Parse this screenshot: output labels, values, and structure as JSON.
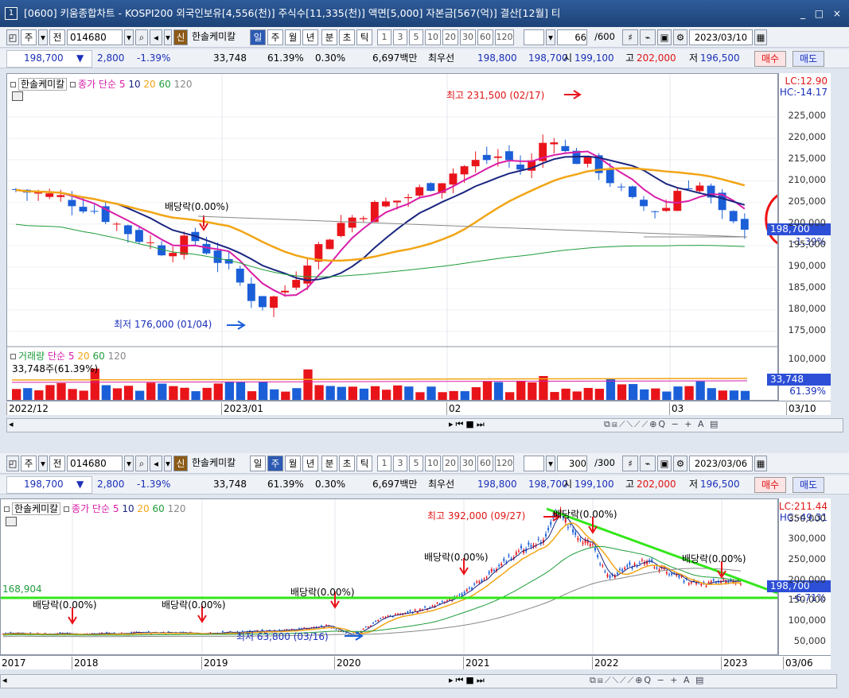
{
  "window": {
    "title": "[0600] 키움종합차트 - KOSPI200 외국인보유[4,556(천)] 주식수[11,335(천)] 액면[5,000] 자본금[567(억)] 결산[12월] 티",
    "number_icon": "1",
    "controls": "_ □ ×"
  },
  "top": {
    "toolbar": {
      "mode": "주",
      "jeon": "전",
      "code": "014680",
      "shin": "신",
      "name": "한솔케미칼",
      "periods": [
        "일",
        "주",
        "월",
        "년"
      ],
      "active_period": "일",
      "intervals": [
        "분",
        "초",
        "틱"
      ],
      "nums": [
        "1",
        "3",
        "5",
        "10",
        "20",
        "30",
        "60",
        "120"
      ],
      "count": "66",
      "count_total": "/600",
      "date": "2023/03/10"
    },
    "quote": {
      "price": "198,700",
      "arrow": "▼",
      "change": "2,800",
      "pct": "-1.39%",
      "volume": "33,748",
      "vol_ratio": "61.39%",
      "turnover": "0.30%",
      "amount": "6,697백만",
      "best_label": "최우선",
      "best_ask": "198,800",
      "best_bid": "198,700",
      "open_label": "시",
      "open": "199,100",
      "high_label": "고",
      "high": "202,000",
      "low_label": "저",
      "low": "196,500",
      "buy": "매수",
      "sell": "매도"
    },
    "legend": {
      "name": "한솔케미칼",
      "price": "종가 단순",
      "ma": [
        "5",
        "10",
        "20",
        "60",
        "120"
      ]
    },
    "lc": "LC:12.90",
    "hc": "HC:-14.17",
    "price_tag": "198,700",
    "price_pct": "-1.39%",
    "high_note": "최고 231,500 (02/17)",
    "low_note": "최저 176,000 (01/04)",
    "div_note": "배당락(0.00%)",
    "vol_legend": {
      "label": "거래량",
      "ma": "단순",
      "ma_vals": [
        "5",
        "20",
        "60",
        "120"
      ],
      "info": "33,748주(61.39%)"
    },
    "vol_tag": "33,748",
    "vol_tag_pct": "61.39%",
    "yticks": [
      "225,000",
      "220,000",
      "215,000",
      "210,000",
      "205,000",
      "200,000",
      "195,000",
      "190,000",
      "185,000",
      "180,000",
      "175,000"
    ],
    "vol_ytick": "100,000",
    "xlabels": [
      "2022/12",
      "2023/01",
      "02",
      "03"
    ],
    "xlabel_right": "03/10"
  },
  "bottom": {
    "toolbar": {
      "mode": "주",
      "jeon": "전",
      "code": "014680",
      "shin": "신",
      "name": "한솔케미칼",
      "periods": [
        "일",
        "주",
        "월",
        "년"
      ],
      "active_period": "주",
      "intervals": [
        "분",
        "초",
        "틱"
      ],
      "nums": [
        "1",
        "3",
        "5",
        "10",
        "20",
        "30",
        "60",
        "120"
      ],
      "count": "300",
      "count_total": "/300",
      "date": "2023/03/06"
    },
    "quote": {
      "price": "198,700",
      "arrow": "▼",
      "change": "2,800",
      "pct": "-1.39%",
      "volume": "33,748",
      "vol_ratio": "61.39%",
      "turnover": "0.30%",
      "amount": "6,697백만",
      "best_label": "최우선",
      "best_ask": "198,800",
      "best_bid": "198,700",
      "open_label": "시",
      "open": "199,100",
      "high_label": "고",
      "high": "202,000",
      "low_label": "저",
      "low": "196,500",
      "buy": "매수",
      "sell": "매도"
    },
    "legend": {
      "name": "한솔케미칼",
      "price": "종가 단순",
      "ma": [
        "5",
        "10",
        "20",
        "60",
        "120"
      ]
    },
    "lc": "LC:211.44",
    "hc": "HC:-49.31",
    "price_tag": "198,700",
    "price_pct": "-6.71%",
    "support_label": "168,904",
    "high_note": "최고 392,000 (09/27)",
    "low_note": "최저 63,800 (03/16)",
    "div_note": "배당락(0.00%)",
    "yticks": [
      "350,000",
      "300,000",
      "250,000",
      "200,000",
      "150,000",
      "100,000",
      "50,000"
    ],
    "xlabels": [
      "2017",
      "2018",
      "2019",
      "2020",
      "2021",
      "2022",
      "2023"
    ],
    "xlabel_right": "03/06"
  },
  "colors": {
    "up": "#e8141a",
    "down": "#1b5fd8",
    "ma5": "#d81ea8",
    "ma10": "#1a2680",
    "ma20": "#f2a516",
    "ma60": "#1f9d3a",
    "ma120": "#888888",
    "trend": "#33e61a",
    "circle": "#ee1111"
  },
  "chart_data": [
    {
      "type": "candlestick",
      "title": "한솔케미칼 일봉",
      "ylim": [
        172000,
        235000
      ],
      "x": [
        "2022/12",
        "2023/01",
        "02",
        "03"
      ],
      "high": 231500,
      "high_date": "02/17",
      "low": 176000,
      "low_date": "01/04",
      "last_close": 198700
    },
    {
      "type": "candlestick",
      "title": "한솔케미칼 주봉",
      "ylim": [
        30000,
        400000
      ],
      "x": [
        "2017",
        "2018",
        "2019",
        "2020",
        "2021",
        "2022",
        "2023"
      ],
      "high": 392000,
      "high_date": "09/27",
      "low": 63800,
      "low_date": "03/16",
      "last_close": 198700
    }
  ]
}
